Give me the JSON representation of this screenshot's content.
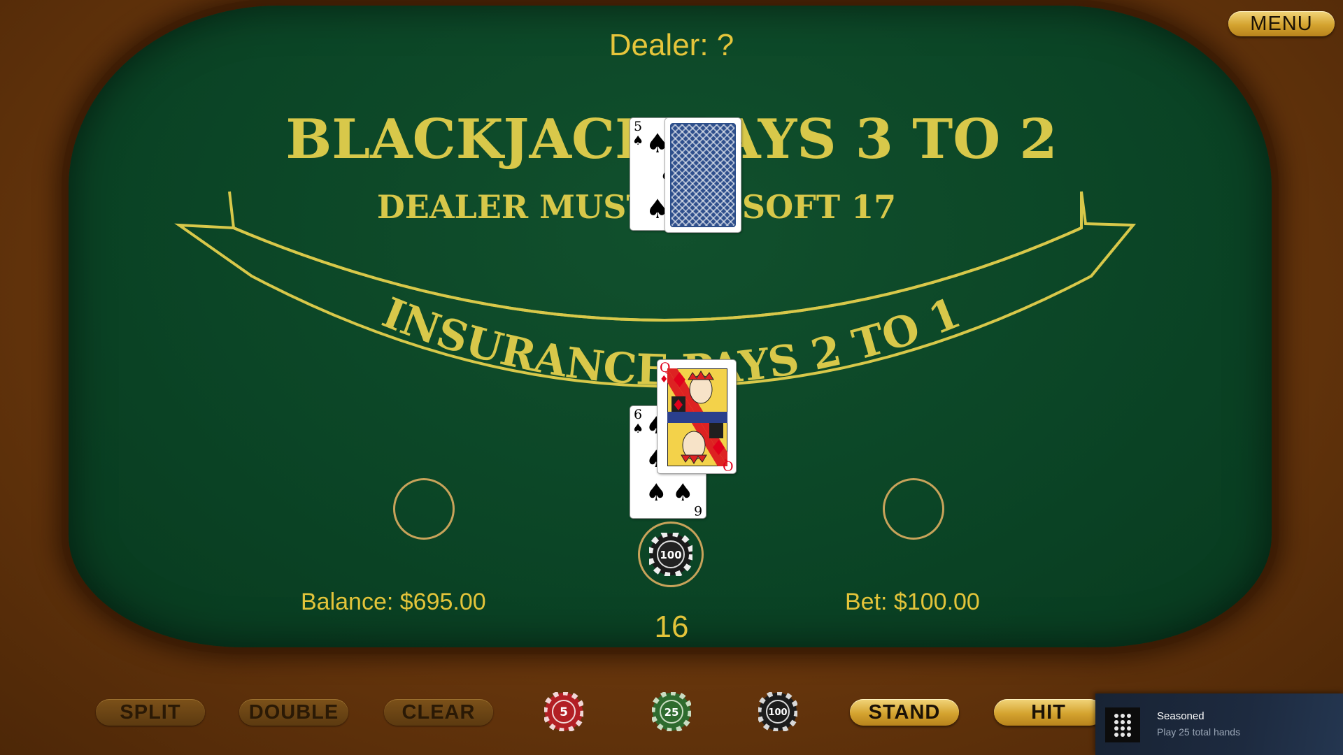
{
  "menu": {
    "label": "MENU"
  },
  "dealer": {
    "label": "Dealer: ?",
    "cards": [
      {
        "rank": "5",
        "suit": "spades",
        "symbol": "♠",
        "color": "#000000",
        "face_up": true
      },
      {
        "face_up": false,
        "back_color": "#2f4f8c"
      }
    ]
  },
  "felt": {
    "headline": "BLACKJACK PAYS 3 TO 2",
    "subline": "DEALER MUST HIT SOFT 17",
    "insurance": "INSURANCE PAYS 2 TO 1",
    "text_color": "#d8c84a"
  },
  "player": {
    "cards": [
      {
        "rank": "6",
        "suit": "spades",
        "symbol": "♠",
        "color": "#000000"
      },
      {
        "rank": "Q",
        "suit": "diamonds",
        "symbol": "♦",
        "color": "#e0001b"
      }
    ],
    "bet_chip": {
      "value": "100",
      "color": "#1a1a1a"
    },
    "hand_total": "16"
  },
  "status": {
    "balance": "Balance: $695.00",
    "bet": "Bet: $100.00"
  },
  "controls": {
    "buttons": [
      {
        "id": "split",
        "label": "SPLIT",
        "enabled": false
      },
      {
        "id": "double",
        "label": "DOUBLE",
        "enabled": false
      },
      {
        "id": "clear",
        "label": "CLEAR",
        "enabled": false
      },
      {
        "id": "stand",
        "label": "STAND",
        "enabled": true
      },
      {
        "id": "hit",
        "label": "HIT",
        "enabled": true
      }
    ],
    "chips": [
      {
        "value": "5",
        "color": "#b21f24"
      },
      {
        "value": "25",
        "color": "#2e6b2e"
      },
      {
        "value": "100",
        "color": "#1c1c1c"
      }
    ]
  },
  "achievement": {
    "title": "Seasoned",
    "subtitle": "Play 25 total hands",
    "icon": "dice-grid-icon"
  }
}
